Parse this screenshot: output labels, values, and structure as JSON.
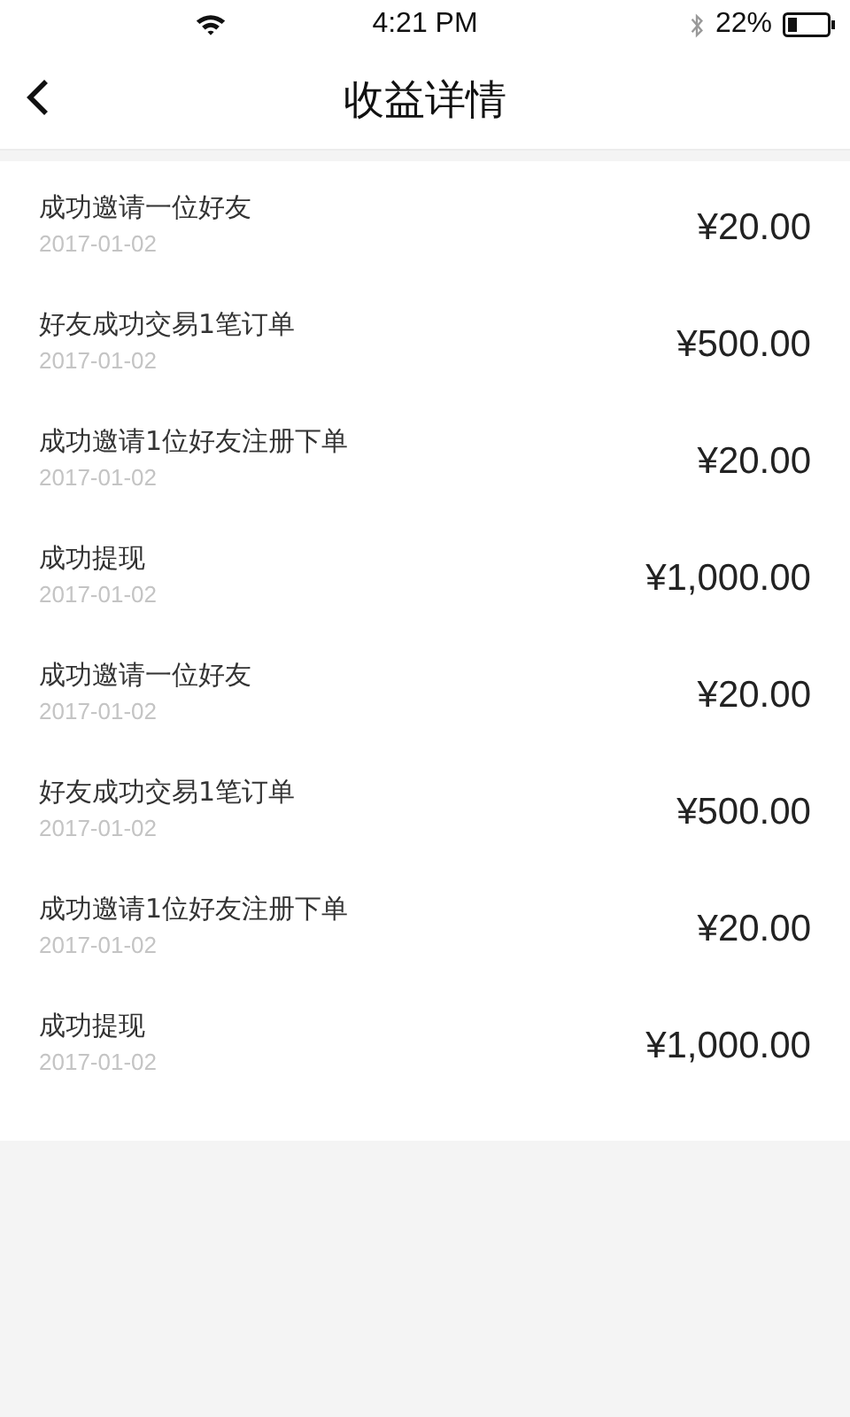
{
  "status_bar": {
    "time": "4:21 PM",
    "battery": "22%"
  },
  "nav": {
    "title": "收益详情"
  },
  "records": [
    {
      "title": "成功邀请一位好友",
      "date": "2017-01-02",
      "amount": "¥20.00"
    },
    {
      "title": "好友成功交易1笔订单",
      "date": "2017-01-02",
      "amount": "¥500.00"
    },
    {
      "title": "成功邀请1位好友注册下单",
      "date": "2017-01-02",
      "amount": "¥20.00"
    },
    {
      "title": "成功提现",
      "date": "2017-01-02",
      "amount": "¥1,000.00"
    },
    {
      "title": "成功邀请一位好友",
      "date": "2017-01-02",
      "amount": "¥20.00"
    },
    {
      "title": "好友成功交易1笔订单",
      "date": "2017-01-02",
      "amount": "¥500.00"
    },
    {
      "title": "成功邀请1位好友注册下单",
      "date": "2017-01-02",
      "amount": "¥20.00"
    },
    {
      "title": "成功提现",
      "date": "2017-01-02",
      "amount": "¥1,000.00"
    }
  ]
}
